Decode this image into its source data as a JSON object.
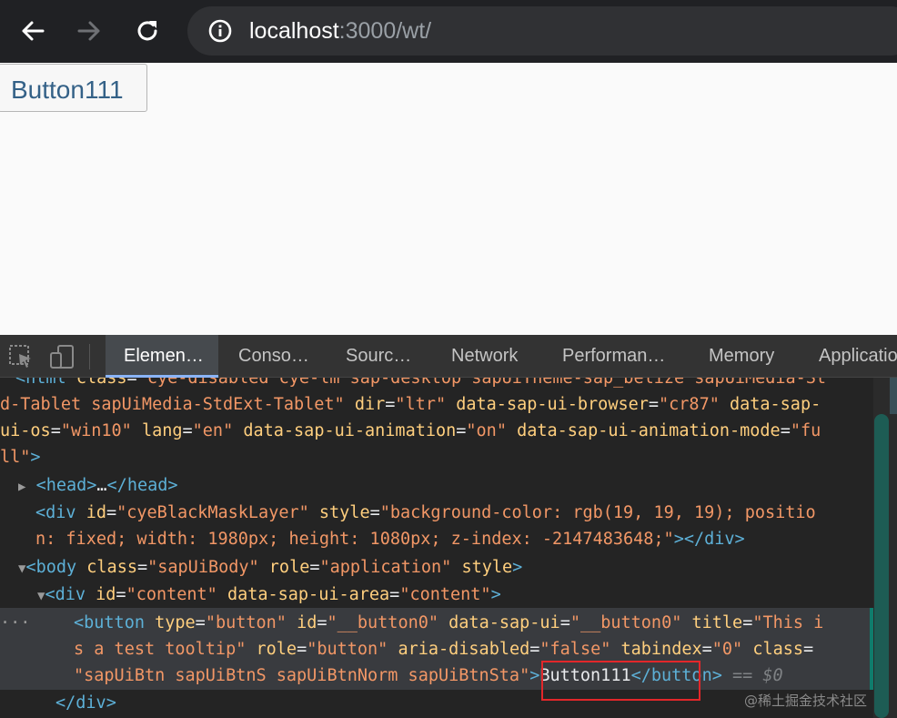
{
  "browser": {
    "url_host": "localhost",
    "url_path": ":3000/wt/",
    "icons": [
      "back-arrow-icon",
      "forward-arrow-icon",
      "reload-icon",
      "info-icon"
    ]
  },
  "page": {
    "button_label": "Button111"
  },
  "devtools": {
    "tabs": [
      "Elemen…",
      "Conso…",
      "Sourc…",
      "Network",
      "Performan…",
      "Memory",
      "Applicatio"
    ],
    "active_tab": "Elemen…",
    "icons": [
      "inspect-element-icon",
      "device-toolbar-icon"
    ],
    "code": {
      "l0": {
        "open": "<",
        "tag": "html",
        "sp": " ",
        "an": "class",
        "eq": "=",
        "av": "\"cye-disabled cye-lm sap-desktop sapUiTheme-sap_belize sapUiMedia-St"
      },
      "l1": {
        "av1": "d-Tablet sapUiMedia-StdExt-Tablet\"",
        "an1": "dir",
        "av2": "\"ltr\"",
        "an2": "data-sap-ui-browser",
        "av3": "\"cr87\"",
        "an3": "data-sap-"
      },
      "l2": {
        "an1": "ui-os",
        "av1": "\"win10\"",
        "an2": "lang",
        "av2": "\"en\"",
        "an3": "data-sap-ui-animation",
        "av3": "\"on\"",
        "an4": "data-sap-ui-animation-mode",
        "av4": "\"fu"
      },
      "l3": {
        "av": "ll\"",
        "close": ">"
      },
      "l4": {
        "tri": "▶",
        "open": "<head>",
        "ell": "…",
        "close": "</head>"
      },
      "l5": {
        "open": "<div",
        "an1": "id",
        "av1": "\"cyeBlackMaskLayer\"",
        "an2": "style",
        "av2": "\"background-color: rgb(19, 19, 19); positio"
      },
      "l6": {
        "av": "n: fixed; width: 1980px; height: 1080px; z-index: -2147483648;\"",
        "gt": ">",
        "close": "</div>"
      },
      "l7": {
        "tri": "▼",
        "open": "<body",
        "an1": "class",
        "av1": "\"sapUiBody\"",
        "an2": "role",
        "av2": "\"application\"",
        "an3": "style",
        "gt": ">"
      },
      "l8": {
        "tri": "▼",
        "open": "<div",
        "an1": "id",
        "av1": "\"content\"",
        "an2": "data-sap-ui-area",
        "av2": "\"content\"",
        "gt": ">"
      },
      "l9": {
        "dots": "···",
        "open": "<button",
        "an1": "type",
        "av1": "\"button\"",
        "an2": "id",
        "av2": "\"__button0\"",
        "an3": "data-sap-ui",
        "av3": "\"__button0\"",
        "an4": "title",
        "av4": "\"This i"
      },
      "l10": {
        "av1": "s a test tooltip\"",
        "an1": "role",
        "av2": "\"button\"",
        "an2": "aria-disabled",
        "av3": "\"false\"",
        "an3": "tabindex",
        "av4": "\"0\"",
        "an4": "class"
      },
      "l11": {
        "av": "\"sapUiBtn sapUiBtnS sapUiBtnNorm sapUiBtnSta\"",
        "gt": ">",
        "text": "Button111",
        "close": "</button>",
        "dim": "== $0"
      },
      "l12": {
        "close": "</div>"
      }
    }
  },
  "watermark": "@稀土掘金技术社区",
  "colors": {
    "highlight": "#e3272a",
    "tag": "#5db0d7",
    "attr_name": "#ffcf7e",
    "attr_value": "#f29766"
  }
}
